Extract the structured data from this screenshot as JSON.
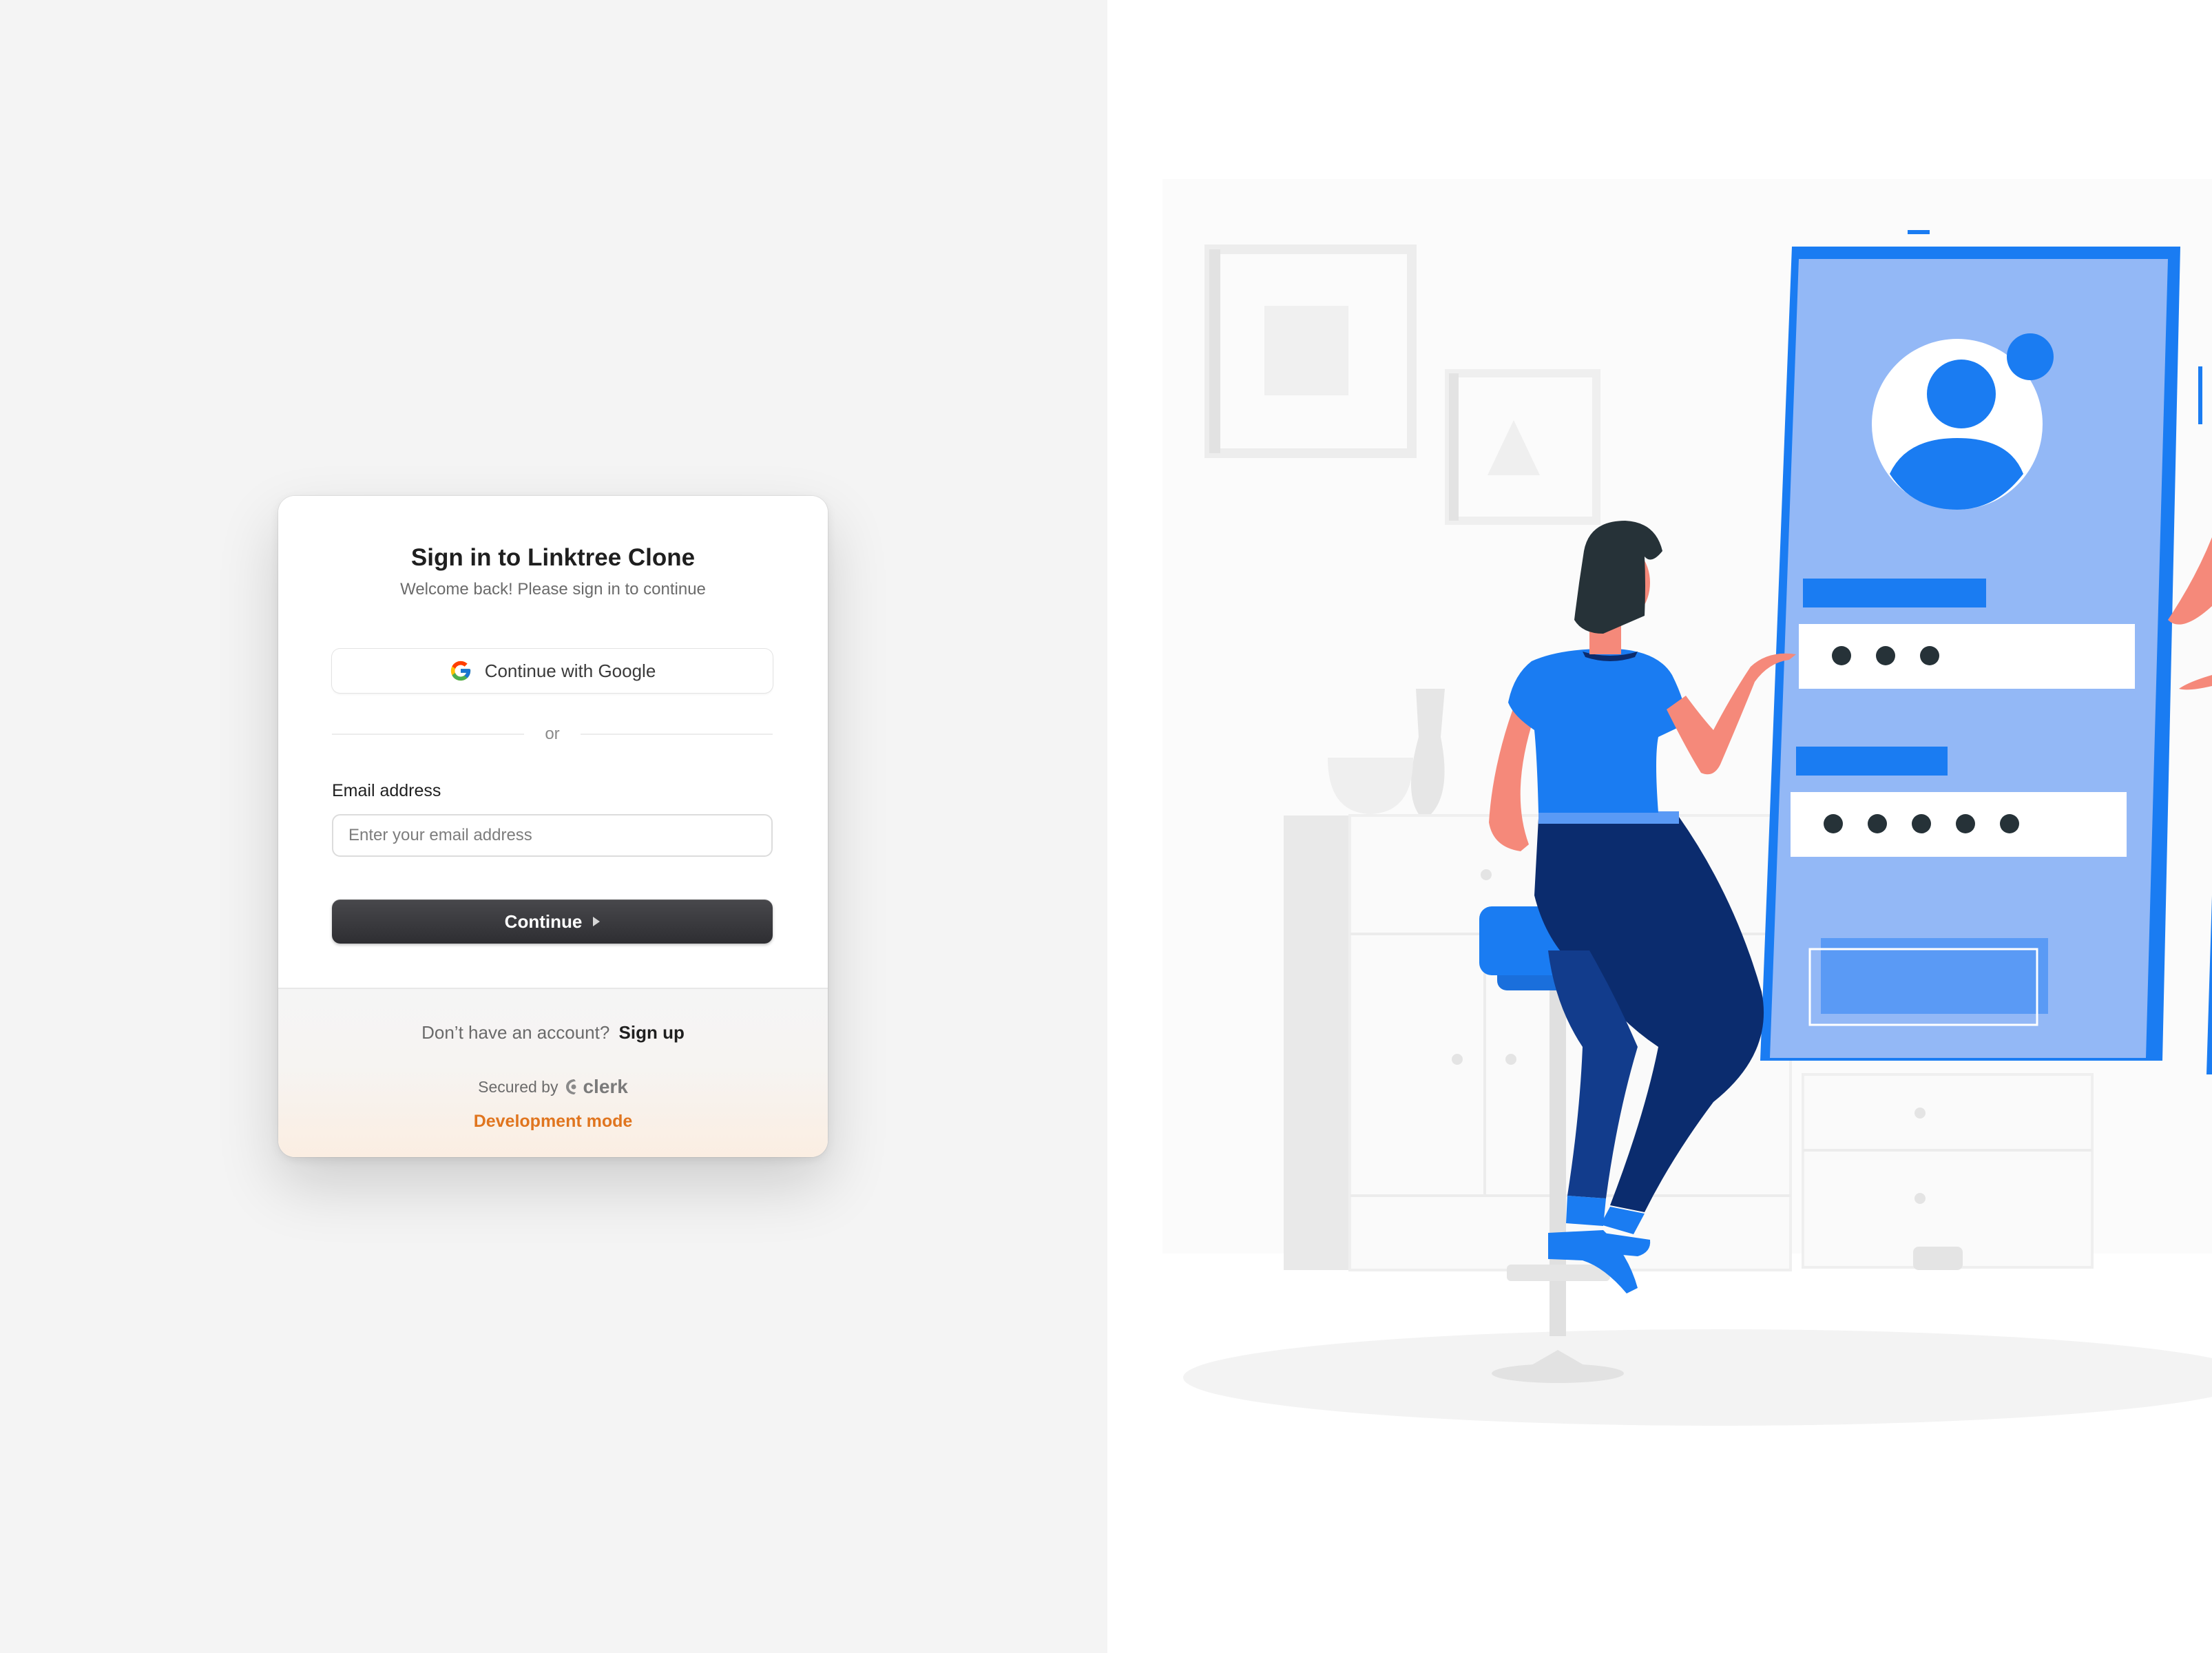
{
  "signin": {
    "title": "Sign in to Linktree Clone",
    "subtitle": "Welcome back! Please sign in to continue",
    "google_label": "Continue with Google",
    "divider": "or",
    "email_label": "Email address",
    "email_placeholder": "Enter your email address",
    "email_value": "",
    "continue_label": "Continue"
  },
  "footer": {
    "no_account": "Don’t have an account?",
    "signup_label": "Sign up",
    "secured_by": "Secured by",
    "clerk_brand": "clerk",
    "dev_mode": "Development mode"
  },
  "colors": {
    "accent_dark": "#2e2e32",
    "dev_mode": "#e0751f",
    "illustration_blue": "#1a7cf2",
    "illustration_light_blue": "#93b8f6",
    "illustration_navy": "#0b2c6e"
  },
  "icons": {
    "google": "google-icon",
    "continue_caret": "caret-right-icon",
    "clerk": "clerk-icon"
  }
}
